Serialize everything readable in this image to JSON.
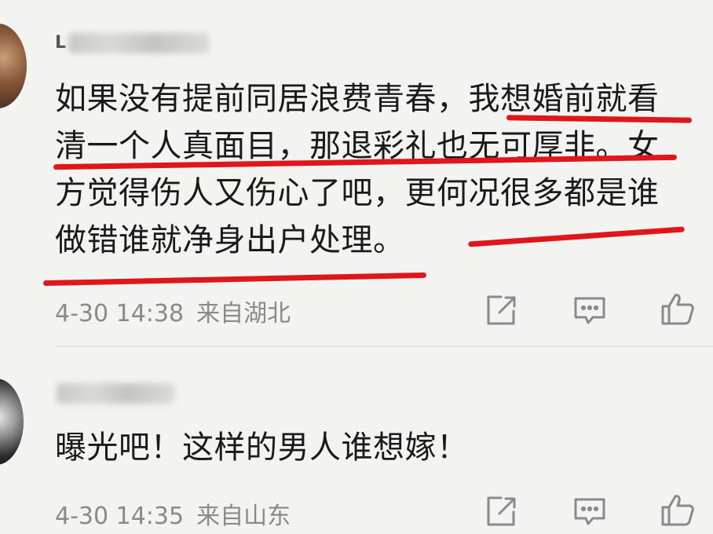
{
  "comments": [
    {
      "username_initial": "L",
      "lines": [
        "如果没有提前同居浪费青春，我想婚前就看",
        "清一个人真面目，那退彩礼也无可厚非。女",
        "方觉得伤人又伤心了吧，更何况很多都是谁",
        "做错谁就净身出户处理。"
      ],
      "time": "4-30 14:38",
      "location": "来自湖北"
    },
    {
      "username_initial": "",
      "lines": [
        "曝光吧！这样的男人谁想嫁！"
      ],
      "time": "4-30 14:35",
      "location": "来自山东"
    }
  ],
  "icons": {
    "share": "share-icon",
    "reply": "comment-icon",
    "like": "thumbs-up-icon"
  },
  "colors": {
    "background": "#f3f3f1",
    "text": "#1a1a1a",
    "meta": "#8a8a8a",
    "underline": "#e0161b"
  }
}
